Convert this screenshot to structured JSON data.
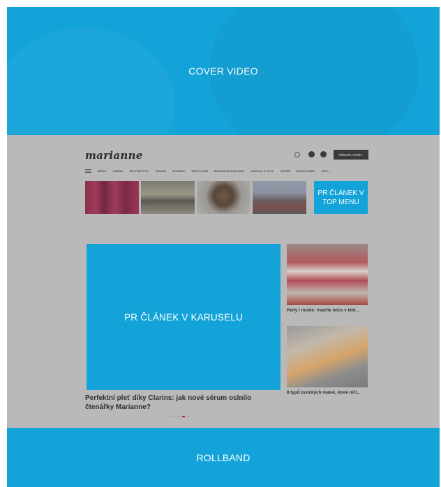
{
  "cover": {
    "label": "COVER VIDEO"
  },
  "rollband": {
    "label": "ROLLBAND"
  },
  "site": {
    "logo": "marianne",
    "subscribe_label": "PŘEDPLATNÉ",
    "nav": [
      "MÓDA",
      "KRÁSA",
      "ŽIVOTNÍ STYL",
      "ZDRAVÍ",
      "STORIES",
      "TESTOVÁNÍ",
      "MARIANNE EVOLENE",
      "VENKOV & STYL",
      "ÚSPĚŠ",
      "ROZHOVORY",
      "VÍCE"
    ],
    "thumbs": [
      {
        "caption": ""
      },
      {
        "caption": ""
      },
      {
        "caption": ""
      },
      {
        "caption": ""
      }
    ],
    "pr_top": {
      "label": "PR ČLÁNEK V TOP MENU"
    },
    "carousel": {
      "label": "PR ČLÁNEK V KARUSELU",
      "headline": "Perfektní pleť díky Clarins: jak nové sérum oslnilo čtenářky Marianne?",
      "dots_total": 5,
      "active_dot": 4
    },
    "side_articles": [
      {
        "title": "Perly i mušle: Vsaďte letos v létě..."
      },
      {
        "title": "8 typů toxických matek, které ničí..."
      }
    ]
  },
  "colors": {
    "placeholder": "#14a3d8",
    "overlay": "#b9b9b9",
    "accent": "#c2185b"
  }
}
